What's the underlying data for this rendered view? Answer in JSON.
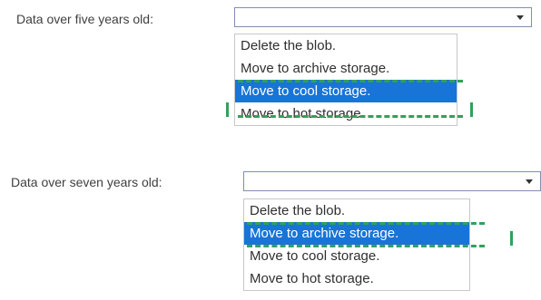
{
  "q1": {
    "label": "Data over five years old:",
    "selected_value": "",
    "options": [
      {
        "label": "Delete the blob."
      },
      {
        "label": "Move to archive storage."
      },
      {
        "label": "Move to cool storage."
      },
      {
        "label": "Move to hot storage."
      }
    ],
    "highlighted_index": 2
  },
  "q2": {
    "label": "Data over seven years old:",
    "selected_value": "",
    "options": [
      {
        "label": "Delete the blob."
      },
      {
        "label": "Move to archive storage."
      },
      {
        "label": "Move to cool storage."
      },
      {
        "label": "Move to hot storage."
      }
    ],
    "highlighted_index": 1
  },
  "colors": {
    "highlight": "#1874d6",
    "answer_marker": "#33a05a"
  }
}
